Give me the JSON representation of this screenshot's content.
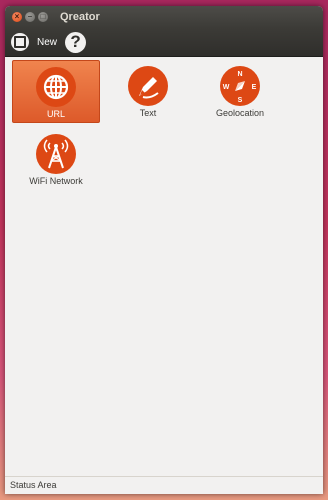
{
  "window": {
    "title": "Qreator"
  },
  "toolbar": {
    "new_label": "New",
    "help_label": "?"
  },
  "items": [
    {
      "label": "URL",
      "icon": "globe-icon",
      "selected": true
    },
    {
      "label": "Text",
      "icon": "pen-icon",
      "selected": false
    },
    {
      "label": "Geolocation",
      "icon": "compass-icon",
      "selected": false
    },
    {
      "label": "WiFi Network",
      "icon": "wifi-tower-icon",
      "selected": false
    }
  ],
  "compass": {
    "n": "N",
    "s": "S",
    "e": "E",
    "w": "W"
  },
  "status": {
    "text": "Status Area"
  },
  "colors": {
    "accent": "#dd4814",
    "titlebar": "#3c3b37",
    "background": "#f2f1f0"
  }
}
